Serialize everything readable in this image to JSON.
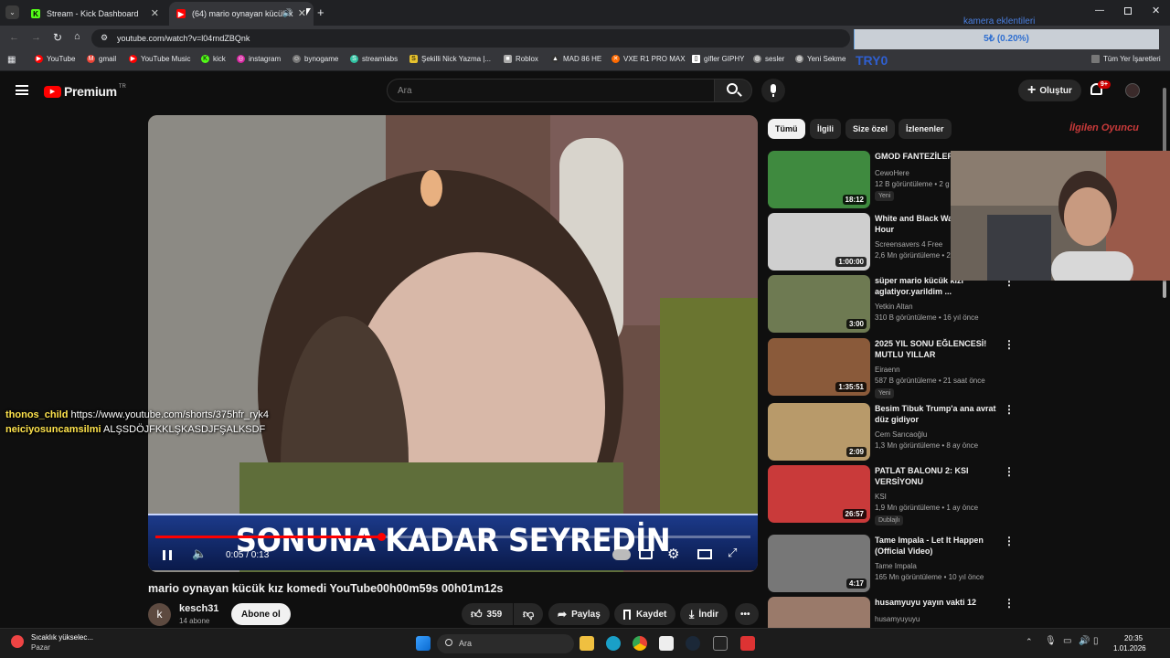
{
  "browser": {
    "tabs": [
      {
        "title": "Stream - Kick Dashboard",
        "active": false
      },
      {
        "title": "(64) mario oynayan kücük k",
        "active": true
      }
    ],
    "url": "youtube.com/watch?v=l04rndZBQnk",
    "bookmarks": [
      "YouTube",
      "gmail",
      "YouTube Music",
      "kick",
      "instagram",
      "bynogame",
      "streamlabs",
      "Şekilli Nick Yazma |...",
      "Roblox",
      "MAD 86 HE",
      "VXE R1 PRO MAX",
      "gifler GIPHY",
      "sesler",
      "Yeni Sekme"
    ],
    "overlay_title": "kamera eklentileri",
    "overlay_progress_label": "5₺ (0.20%)",
    "overlay_progress": 0.2,
    "overlay_tag": "TRY0",
    "overlay_right": "Tüm Yer İşaretleri"
  },
  "youtube": {
    "logo": "Premium",
    "logo_sup": "TR",
    "search_placeholder": "Ara",
    "create_label": "Oluştur",
    "notif_count": "9+",
    "video": {
      "caption": "SONUNA KADAR SEYREDİN",
      "time": "0:05 / 0:13",
      "progress": 0.38,
      "title": "mario oynayan kücük kız komedi YouTube00h00m59s 00h01m12s",
      "channel": "kesch31",
      "subs": "14 abone",
      "subscribe_label": "Abone ol",
      "likes": "359",
      "share_label": "Paylaş",
      "save_label": "Kaydet",
      "download_label": "İndir"
    },
    "chips": [
      "Tümü",
      "İlgili",
      "Size özel",
      "İzlenenler"
    ],
    "recs": [
      {
        "title": "GMOD FANTEZİLER",
        "channel": "CewoHere",
        "meta": "12 B görüntüleme • 2 g",
        "duration": "18:12",
        "badge": "Yeni",
        "thumb": "#3f8a3f"
      },
      {
        "title": "White and Black Wa Engine 1 Hour",
        "channel": "Screensavers 4 Free",
        "meta": "2,6 Mn görüntüleme • 2",
        "duration": "1:00:00",
        "badge": "",
        "thumb": "#cfcfcf"
      },
      {
        "title": "süper mario kücük kızı aglatiyor.yarildim ...",
        "channel": "Yetkin Altan",
        "meta": "310 B görüntüleme • 16 yıl önce",
        "duration": "3:00",
        "badge": "",
        "thumb": "#6e7a52"
      },
      {
        "title": "2025 YIL SONU EĞLENCESİ! MUTLU YILLAR",
        "channel": "Eiraenn",
        "meta": "587 B görüntüleme • 21 saat önce",
        "duration": "1:35:51",
        "badge": "Yeni",
        "thumb": "#8a5a3a"
      },
      {
        "title": "Besim Tibuk Trump'a ana avrat düz gidiyor",
        "channel": "Cem Sarıcaoğlu",
        "meta": "1,3 Mn görüntüleme • 8 ay önce",
        "duration": "2:09",
        "badge": "",
        "thumb": "#b89a6a"
      },
      {
        "title": "PATLAT BALONU 2: KSI VERSİYONU",
        "channel": "KSI",
        "meta": "1,9 Mn görüntüleme • 1 ay önce",
        "duration": "26:57",
        "badge": "Dublajlı",
        "thumb": "#c93a3a"
      },
      {
        "title": "Tame Impala - Let It Happen (Official Video)",
        "channel": "Tame Impala",
        "meta": "165 Mn görüntüleme • 10 yıl önce",
        "duration": "4:17",
        "badge": "",
        "thumb": "#777"
      },
      {
        "title": "husamyuyu yayın vakti 12",
        "channel": "husamyuyuyu",
        "meta": "",
        "duration": "",
        "badge": "",
        "thumb": "#9a7a6a"
      }
    ],
    "cam_logo": "İlgilen Oyuncu"
  },
  "chat": [
    {
      "user": "thonos_child",
      "msg": "https://www.youtube.com/shorts/375hfr_ryk4"
    },
    {
      "user": "neiciyosuncamsilmi",
      "msg": "ALŞSDÖJFKKLŞKASDJFŞALKSDF"
    }
  ],
  "taskbar": {
    "weather": "Sıcaklık yükselec...",
    "weather_sub": "Pazar",
    "search": "Ara",
    "time": "20:35",
    "date": "1.01.2026"
  }
}
